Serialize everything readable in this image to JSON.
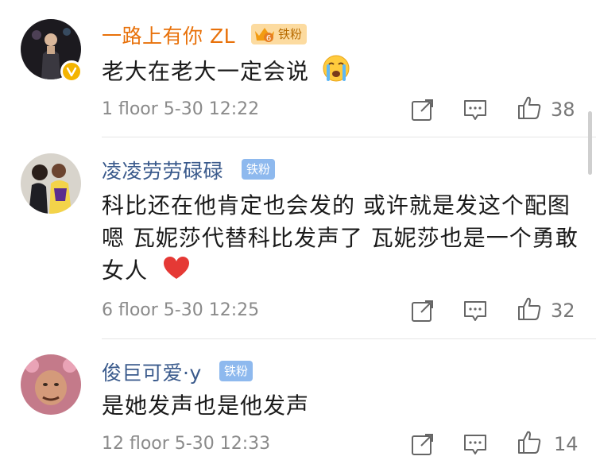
{
  "comments": [
    {
      "username": "一路上有你 ZL",
      "badge": "铁粉",
      "badge_level": "6",
      "text": "老大在老大一定会说",
      "emoji": "crying-face",
      "meta": "1 floor 5-30 12:22",
      "likes": "38",
      "verified": true
    },
    {
      "username": "凌凌劳劳碌碌",
      "badge": "铁粉",
      "text": "科比还在他肯定也会发的 或许就是发这个配图 嗯 瓦妮莎代替科比发声了 瓦妮莎也是一个勇敢女人",
      "emoji": "red-heart",
      "meta": "6 floor 5-30 12:25",
      "likes": "32"
    },
    {
      "username": "俊巨可爱·y",
      "badge": "铁粉",
      "text": "是她发声也是他发声",
      "meta": "12 floor 5-30 12:33",
      "likes": "14"
    }
  ],
  "colors": {
    "gold_username": "#e8710a",
    "blue_username": "#3a5a8c",
    "meta_gray": "#8a8a8a",
    "gold_badge_bg": "#fcdba0",
    "blue_badge_bg": "#8eb9ee"
  },
  "icons": [
    "share-icon",
    "reply-icon",
    "like-icon",
    "verified-icon",
    "crown-icon"
  ]
}
